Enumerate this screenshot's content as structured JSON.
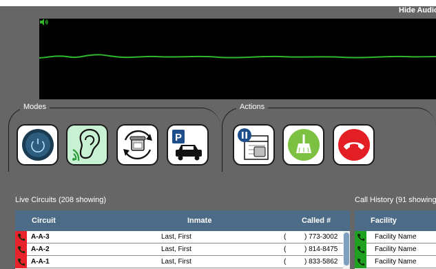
{
  "audio": {
    "hide_label": "Hide Audio"
  },
  "modes": {
    "title": "Modes",
    "buttons": [
      {
        "icon": "power-icon"
      },
      {
        "icon": "ear-listen-icon",
        "active": true
      },
      {
        "icon": "phone-transfer-icon"
      },
      {
        "icon": "parking-car-icon"
      }
    ]
  },
  "actions": {
    "title": "Actions",
    "buttons": [
      {
        "icon": "pause-calendar-phone-icon"
      },
      {
        "icon": "broom-clean-icon"
      },
      {
        "icon": "hang-up-icon"
      }
    ]
  },
  "live_circuits": {
    "title": "Live Circuits (208 showing)",
    "columns": [
      "Circuit",
      "Inmate",
      "Called #"
    ],
    "rows": [
      {
        "circuit": "A-A-3",
        "inmate": "Last, First",
        "paren": "(",
        "number": ") 773-3002",
        "status": "red"
      },
      {
        "circuit": "A-A-2",
        "inmate": "Last, First",
        "paren": "(",
        "number": ") 814-8475",
        "status": "red"
      },
      {
        "circuit": "A-A-1",
        "inmate": "Last, First",
        "paren": "(",
        "number": ") 833-5862",
        "status": "red"
      }
    ]
  },
  "call_history": {
    "title": "Call History (91 showing",
    "columns": [
      "Facility"
    ],
    "rows": [
      {
        "facility": "Facility Name",
        "status": "green"
      },
      {
        "facility": "Facility Name",
        "status": "green"
      },
      {
        "facility": "Facility Name",
        "status": "green"
      }
    ]
  },
  "colors": {
    "header": "#4b6b86",
    "live_flag": "#e8232b",
    "history_flag": "#20a020",
    "waveform": "#2fb82f",
    "accent_green": "#7dc142",
    "hangup_red": "#e31e24"
  }
}
